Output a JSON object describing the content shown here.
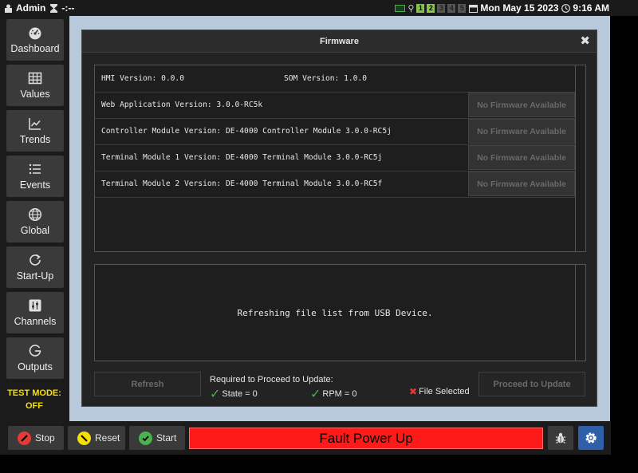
{
  "topbar": {
    "user": "Admin",
    "timer": "-:--",
    "channels": [
      "1",
      "2",
      "3",
      "4",
      "5"
    ],
    "datetime": "Mon May 15 2023",
    "time": "9:16 AM"
  },
  "sidebar": {
    "items": [
      {
        "label": "Dashboard",
        "icon": "dashboard-icon"
      },
      {
        "label": "Values",
        "icon": "grid-icon"
      },
      {
        "label": "Trends",
        "icon": "chart-icon"
      },
      {
        "label": "Events",
        "icon": "list-icon"
      },
      {
        "label": "Global",
        "icon": "globe-icon"
      },
      {
        "label": "Start-Up",
        "icon": "refresh-icon"
      },
      {
        "label": "Channels",
        "icon": "sliders-icon"
      },
      {
        "label": "Outputs",
        "icon": "output-icon"
      }
    ],
    "test_mode_label": "TEST MODE:",
    "test_mode_value": "OFF"
  },
  "modal": {
    "title": "Firmware",
    "close": "✖",
    "hmi": "HMI Version: 0.0.0",
    "som": "SOM Version: 1.0.0",
    "rows": [
      {
        "text": "Web Application Version: 3.0.0-RC5k",
        "button": "No Firmware Available"
      },
      {
        "text": "Controller Module Version: DE-4000 Controller Module 3.0.0-RC5j",
        "button": "No Firmware Available"
      },
      {
        "text": "Terminal Module 1 Version: DE-4000 Terminal Module 3.0.0-RC5j",
        "button": "No Firmware Available"
      },
      {
        "text": "Terminal Module 2 Version: DE-4000 Terminal Module 3.0.0-RC5f",
        "button": "No Firmware Available"
      }
    ],
    "message": "Refreshing file list from USB Device.",
    "refresh_label": "Refresh",
    "required_title": "Required to Proceed to Update:",
    "req_state": "State = 0",
    "req_rpm": "RPM = 0",
    "req_file": "File Selected",
    "proceed_label": "Proceed to Update"
  },
  "bottombar": {
    "stop": "Stop",
    "reset": "Reset",
    "start": "Start",
    "fault": "Fault Power Up"
  },
  "colors": {
    "fault": "#ff1a1a",
    "accent": "#2f5fa8",
    "test_mode": "#f5e000"
  }
}
